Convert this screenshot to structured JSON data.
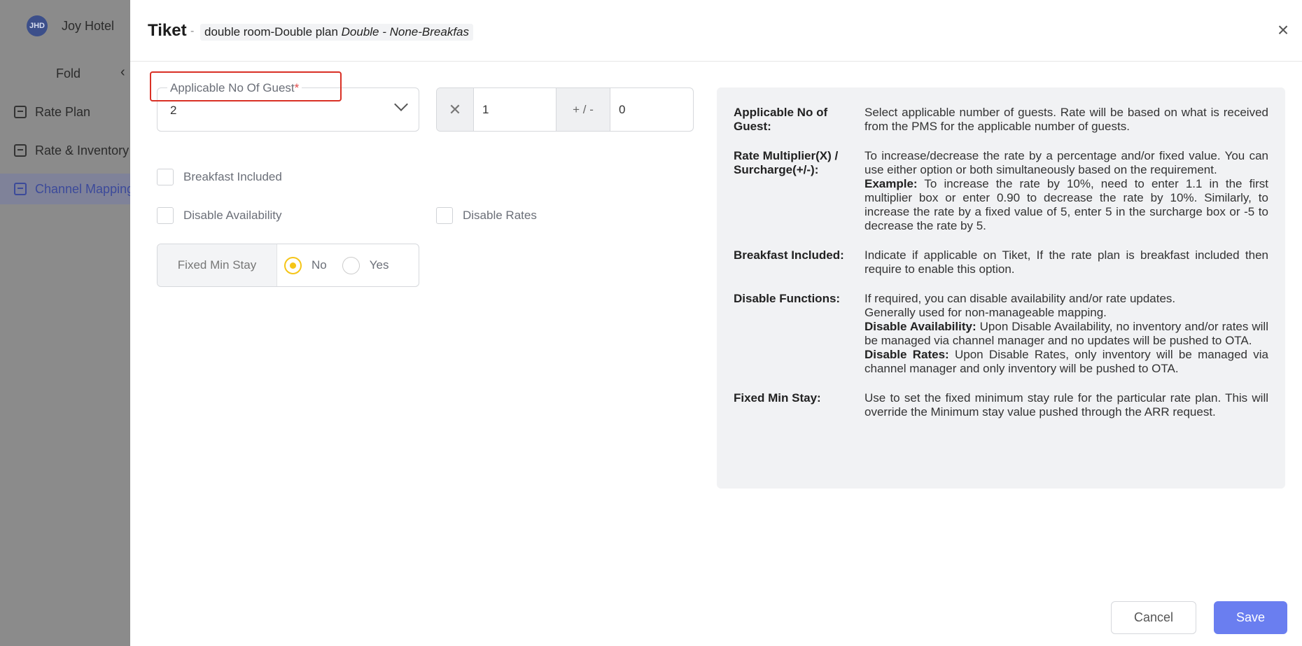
{
  "sidebar": {
    "brand_logo_text": "JHD",
    "brand_name": "Joy Hotel",
    "fold_label": "Fold",
    "items": [
      {
        "label": "Rate Plan",
        "icon": "rate-plan-icon"
      },
      {
        "label": "Rate & Inventory",
        "icon": "rate-inventory-icon"
      },
      {
        "label": "Channel Mapping",
        "icon": "channel-mapping-icon",
        "active": true
      }
    ]
  },
  "modal": {
    "channel": "Tiket",
    "dash": "-",
    "room_plan": "double room-Double plan",
    "room_plan_italic": "Double - None-Breakfas"
  },
  "form": {
    "guest_label": "Applicable No Of Guest",
    "guest_required_mark": "*",
    "guest_value": "2",
    "multiplier_symbol": "✕",
    "multiplier_value": "1",
    "surcharge_symbol": "+ / -",
    "surcharge_value": "0",
    "breakfast_label": "Breakfast Included",
    "disable_availability_label": "Disable Availability",
    "disable_rates_label": "Disable Rates",
    "min_stay_label": "Fixed Min Stay",
    "min_stay_options": [
      {
        "label": "No",
        "selected": true
      },
      {
        "label": "Yes",
        "selected": false
      }
    ]
  },
  "help": {
    "guest_term": "Applicable No of Guest:",
    "guest_desc": "Select applicable number of guests. Rate will be based on what is received from the PMS for the applicable number of guests.",
    "rate_term": "Rate Multiplier(X) / Surcharge(+/-):",
    "rate_desc": "To increase/decrease the rate by a percentage and/or fixed value. You can use either option or both simultaneously based on the requirement.",
    "rate_example_label": "Example:",
    "rate_example_text": "To increase the rate by 10%, need to enter 1.1 in the first multiplier box or enter 0.90 to decrease the rate by 10%. Similarly, to increase the rate by a fixed value of 5, enter 5 in the surcharge box or -5 to decrease the rate by 5.",
    "breakfast_term": "Breakfast Included:",
    "breakfast_desc": "Indicate if applicable on Tiket, If the rate plan is breakfast included then require to enable this option.",
    "disable_term": "Disable Functions:",
    "disable_desc_1": "If required, you can disable availability and/or rate updates.",
    "disable_desc_2": "Generally used for non-manageable mapping.",
    "disable_avail_label": "Disable Availability:",
    "disable_avail_text": "Upon Disable Availability, no inventory and/or rates will be managed via channel manager and no updates will be pushed to OTA.",
    "disable_rates_label": "Disable Rates:",
    "disable_rates_text": "Upon Disable Rates, only inventory will be managed via channel manager and only inventory will be pushed to OTA.",
    "minstay_term": "Fixed Min Stay:",
    "minstay_desc": "Use to set the fixed minimum stay rule for the particular rate plan. This will override the Minimum stay value pushed through the ARR request."
  },
  "footer": {
    "cancel_label": "Cancel",
    "save_label": "Save"
  },
  "colors": {
    "primary": "#6a7ef0",
    "radio_selected": "#f5c518",
    "highlight": "#d93025",
    "required": "#e24a4a"
  }
}
